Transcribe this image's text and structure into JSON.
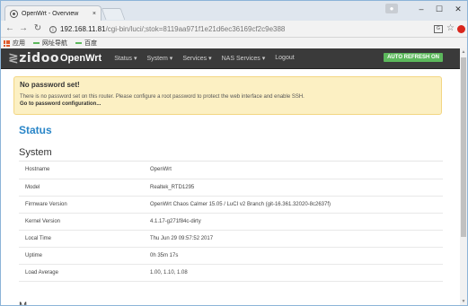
{
  "browser": {
    "tab_title": "OpenWrt - Overview",
    "tab_close": "×",
    "window_controls": {
      "minimize": "–",
      "maximize": "☐",
      "close": "✕"
    },
    "url_host": "192.168.11.81",
    "url_path": "/cgi-bin/luci/;stok=8119aa971f1e21d6ec36169cf2c9e388",
    "bookmarks": [
      {
        "label": "应用",
        "icon": "apps-icon"
      },
      {
        "label": "网址导航",
        "icon": "bookmark-icon"
      },
      {
        "label": "百度",
        "icon": "bookmark-icon"
      }
    ]
  },
  "navbar": {
    "brand_logo": "zidoo",
    "brand_name": "OpenWrt",
    "menu": [
      {
        "label": "Status ▾"
      },
      {
        "label": "System ▾"
      },
      {
        "label": "Services ▾"
      },
      {
        "label": "NAS Services ▾"
      },
      {
        "label": "Logout"
      }
    ],
    "auto_refresh": "AUTO REFRESH ON",
    "auto_refresh_color": "#5cb85c"
  },
  "alert": {
    "title": "No password set!",
    "text": "There is no password set on this router. Please configure a root password to protect the web interface and enable SSH.",
    "link": "Go to password configuration..."
  },
  "page_title": "Status",
  "section_title": "System",
  "next_section_title": "M",
  "system_rows": [
    {
      "key": "Hostname",
      "value": "OpenWrt"
    },
    {
      "key": "Model",
      "value": "Realtek_RTD1295"
    },
    {
      "key": "Firmware Version",
      "value": "OpenWrt Chaos Calmer 15.05 / LuCI v2 Branch (git-16.361.32020-8c2637f)"
    },
    {
      "key": "Kernel Version",
      "value": "4.1.17-g271f84c-dirty"
    },
    {
      "key": "Local Time",
      "value": "Thu Jun 29 09:57:52 2017"
    },
    {
      "key": "Uptime",
      "value": "0h 35m 17s"
    },
    {
      "key": "Load Average",
      "value": "1.00, 1.10, 1.08"
    }
  ],
  "colors": {
    "accent": "#2a86c8",
    "navbar": "#3a3a3a",
    "alert_bg": "#fcf0c3"
  }
}
